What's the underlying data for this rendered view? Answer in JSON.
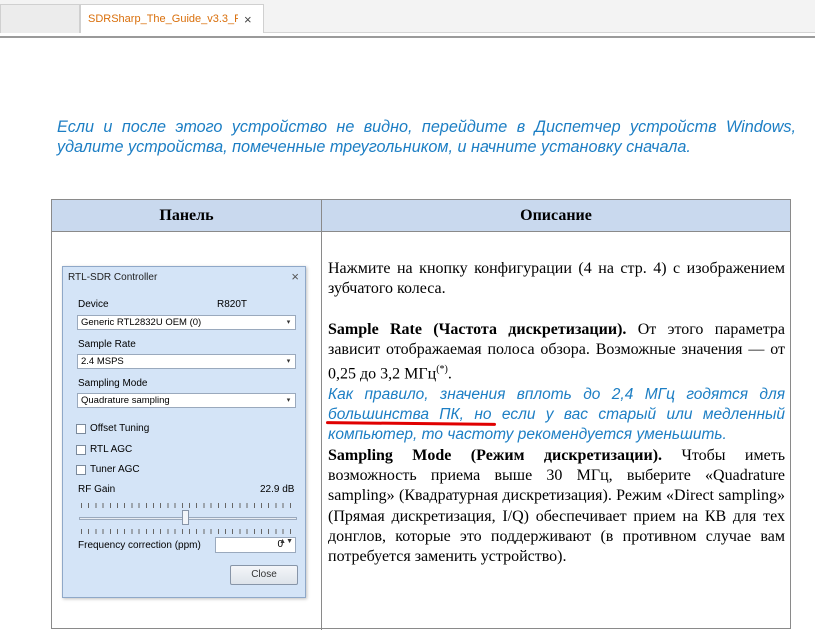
{
  "tabs": [
    {
      "label": ""
    },
    {
      "label": "SDRSharp_The_Guide_v3.3_R..."
    }
  ],
  "tab_close": "×",
  "note": "Если и после этого устройство не видно, перейдите в Диспетчер устройств Windows, удалите устройства, помеченные треугольником, и начните установку сначала.",
  "table": {
    "col1": "Панель",
    "col2": "Описание"
  },
  "dialog": {
    "title": "RTL-SDR Controller",
    "close": "×",
    "device_label": "Device",
    "device_tuner": "R820T",
    "device_value": "Generic RTL2832U OEM (0)",
    "sample_rate_label": "Sample Rate",
    "sample_rate_value": "2.4 MSPS",
    "sampling_mode_label": "Sampling Mode",
    "sampling_mode_value": "Quadrature sampling",
    "offset_tuning": "Offset Tuning",
    "rtl_agc": "RTL AGC",
    "tuner_agc": "Tuner AGC",
    "rf_gain_label": "RF Gain",
    "rf_gain_value": "22.9 dB",
    "rf_gain_level": 0.49,
    "freq_corr_label": "Frequency correction (ppm)",
    "freq_corr_value": "0",
    "close_button": "Close",
    "arrow": "▾",
    "spin": "▲▼"
  },
  "description": {
    "p1": "Нажмите на кнопку конфигурации (4 на стр. 4) с изображением зубчатого колеса.",
    "sr_bold": "Sample Rate (Частота дискретизации).",
    "sr_text": " От этого параметра зависит отображаемая полоса обзора. Возможные значения — от 0,25 до 3,2 МГц",
    "sr_sup": "(*)",
    "sr_end": ".",
    "blue": "Как правило, значения вплоть до 2,4 МГц годятся для большинства ПК, но если у вас старый или медленный компьютер, то частоту рекомендуется уменьшить.",
    "sm_bold": "Sampling Mode (Режим дискретизации).",
    "sm_text": " Чтобы иметь возможность приема выше 30 МГц, выберите «Quadrature sampling» (Квадратурная дискретизация). Режим «Direct sampling» (Прямая дискретизация, I/Q) обеспечивает прием на КВ для тех донглов, которые это поддерживают (в противном случае вам потребуется заменить устройство)."
  },
  "colors": {
    "tab_text": "#d96f0b",
    "note_blue": "#1c7ec4",
    "header_bg": "#c9d9ee",
    "dialog_bg": "#d4e4f7",
    "underline_red": "#e00000"
  }
}
